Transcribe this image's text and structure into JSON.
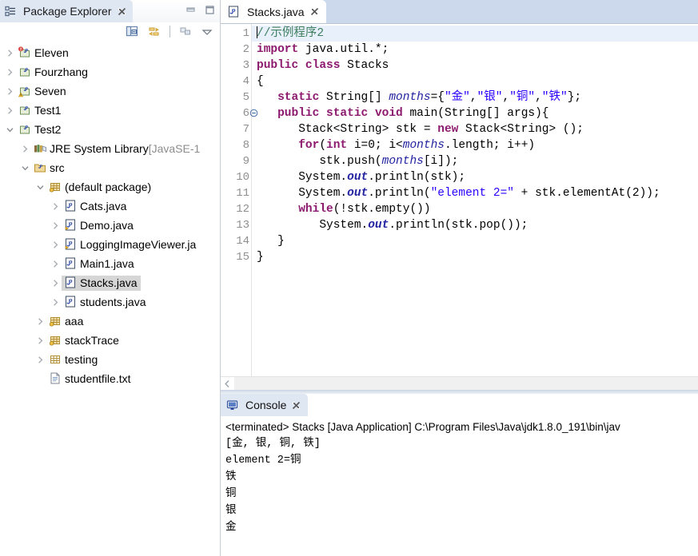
{
  "explorer": {
    "tab": {
      "title": "Package Explorer",
      "icon": "package-explorer-icon",
      "close_icon": "close-icon"
    },
    "window_buttons": [
      {
        "name": "minimize-icon",
        "label": "Minimize"
      },
      {
        "name": "maximize-icon",
        "label": "Maximize"
      }
    ],
    "toolbar": [
      {
        "name": "collapse-all-icon",
        "label": "Collapse All"
      },
      {
        "name": "link-with-editor-icon",
        "label": "Link with Editor"
      },
      {
        "name": "view-menu-icon",
        "label": "View Menu"
      },
      {
        "name": "chevron-down-icon",
        "label": "View Menu"
      }
    ],
    "tree": [
      {
        "label": "Eleven",
        "icon": "java-project-error-icon",
        "twist": "collapsed",
        "indent": 0,
        "selected": false
      },
      {
        "label": "Fourzhang",
        "icon": "java-project-icon",
        "twist": "collapsed",
        "indent": 0,
        "selected": false
      },
      {
        "label": "Seven",
        "icon": "java-project-warning-icon",
        "twist": "collapsed",
        "indent": 0,
        "selected": false
      },
      {
        "label": "Test1",
        "icon": "java-project-icon",
        "twist": "collapsed",
        "indent": 0,
        "selected": false
      },
      {
        "label": "Test2",
        "icon": "java-project-icon",
        "twist": "expanded",
        "indent": 0,
        "selected": false
      },
      {
        "label": "JRE System Library",
        "sublabel": " [JavaSE-1",
        "icon": "jre-library-icon",
        "twist": "collapsed",
        "indent": 1,
        "selected": false
      },
      {
        "label": "src",
        "icon": "source-folder-icon",
        "twist": "expanded",
        "indent": 1,
        "selected": false
      },
      {
        "label": "(default package)",
        "icon": "package-icon",
        "twist": "expanded",
        "indent": 2,
        "selected": false
      },
      {
        "label": "Cats.java",
        "icon": "java-file-icon",
        "twist": "collapsed",
        "indent": 3,
        "selected": false
      },
      {
        "label": "Demo.java",
        "icon": "java-file-main-icon",
        "twist": "collapsed",
        "indent": 3,
        "selected": false
      },
      {
        "label": "LoggingImageViewer.ja",
        "icon": "java-file-main-icon",
        "twist": "collapsed",
        "indent": 3,
        "selected": false
      },
      {
        "label": "Main1.java",
        "icon": "java-file-icon",
        "twist": "collapsed",
        "indent": 3,
        "selected": false
      },
      {
        "label": "Stacks.java",
        "icon": "java-file-icon",
        "twist": "collapsed",
        "indent": 3,
        "selected": true
      },
      {
        "label": "students.java",
        "icon": "java-file-icon",
        "twist": "collapsed",
        "indent": 3,
        "selected": false
      },
      {
        "label": "aaa",
        "icon": "package-icon",
        "twist": "collapsed",
        "indent": 2,
        "selected": false
      },
      {
        "label": "stackTrace",
        "icon": "package-icon",
        "twist": "collapsed",
        "indent": 2,
        "selected": false
      },
      {
        "label": "testing",
        "icon": "package-empty-icon",
        "twist": "collapsed",
        "indent": 2,
        "selected": false
      },
      {
        "label": "studentfile.txt",
        "icon": "text-file-icon",
        "twist": "none",
        "indent": 2,
        "selected": false
      }
    ]
  },
  "editor": {
    "tab": {
      "title": "Stacks.java",
      "icon": "java-file-icon",
      "close_icon": "close-icon"
    },
    "line_numbers": [
      "1",
      "2",
      "3",
      "4",
      "5",
      "6",
      "7",
      "8",
      "9",
      "10",
      "11",
      "12",
      "13",
      "14",
      "15"
    ],
    "fold_line": "6",
    "current_line": 1,
    "code": [
      "//示例程序2",
      "import java.util.*;",
      "public class Stacks",
      "{",
      "   static String[] months={\"金\",\"银\",\"铜\",\"铁\"};",
      "   public static void main(String[] args){",
      "      Stack<String> stk = new Stack<String> ();",
      "      for(int i=0; i<months.length; i++)",
      "         stk.push(months[i]);",
      "      System.out.println(stk);",
      "      System.out.println(\"element 2=\" + stk.elementAt(2));",
      "      while(!stk.empty())",
      "         System.out.println(stk.pop());",
      "   }",
      "}"
    ],
    "hscroll": {
      "left_icon": "scroll-left-icon"
    }
  },
  "console": {
    "tab": {
      "title": "Console",
      "icon": "console-icon",
      "close_icon": "close-icon"
    },
    "header": "<terminated> Stacks [Java Application] C:\\Program Files\\Java\\jdk1.8.0_191\\bin\\jav",
    "output": [
      "[金, 银, 铜, 铁]",
      "element 2=铜",
      "铁",
      "铜",
      "银",
      "金"
    ]
  },
  "colors": {
    "tab_active_bg": "#dfe7f3",
    "editor_tabrow_bg": "#ccd9ec",
    "selection_bg": "#d6d6d6",
    "current_line_bg": "#e8f0fb",
    "keyword": "#8c1a6e",
    "string": "#2a00ff",
    "comment": "#3f7f5f",
    "field": "#2323a0"
  }
}
